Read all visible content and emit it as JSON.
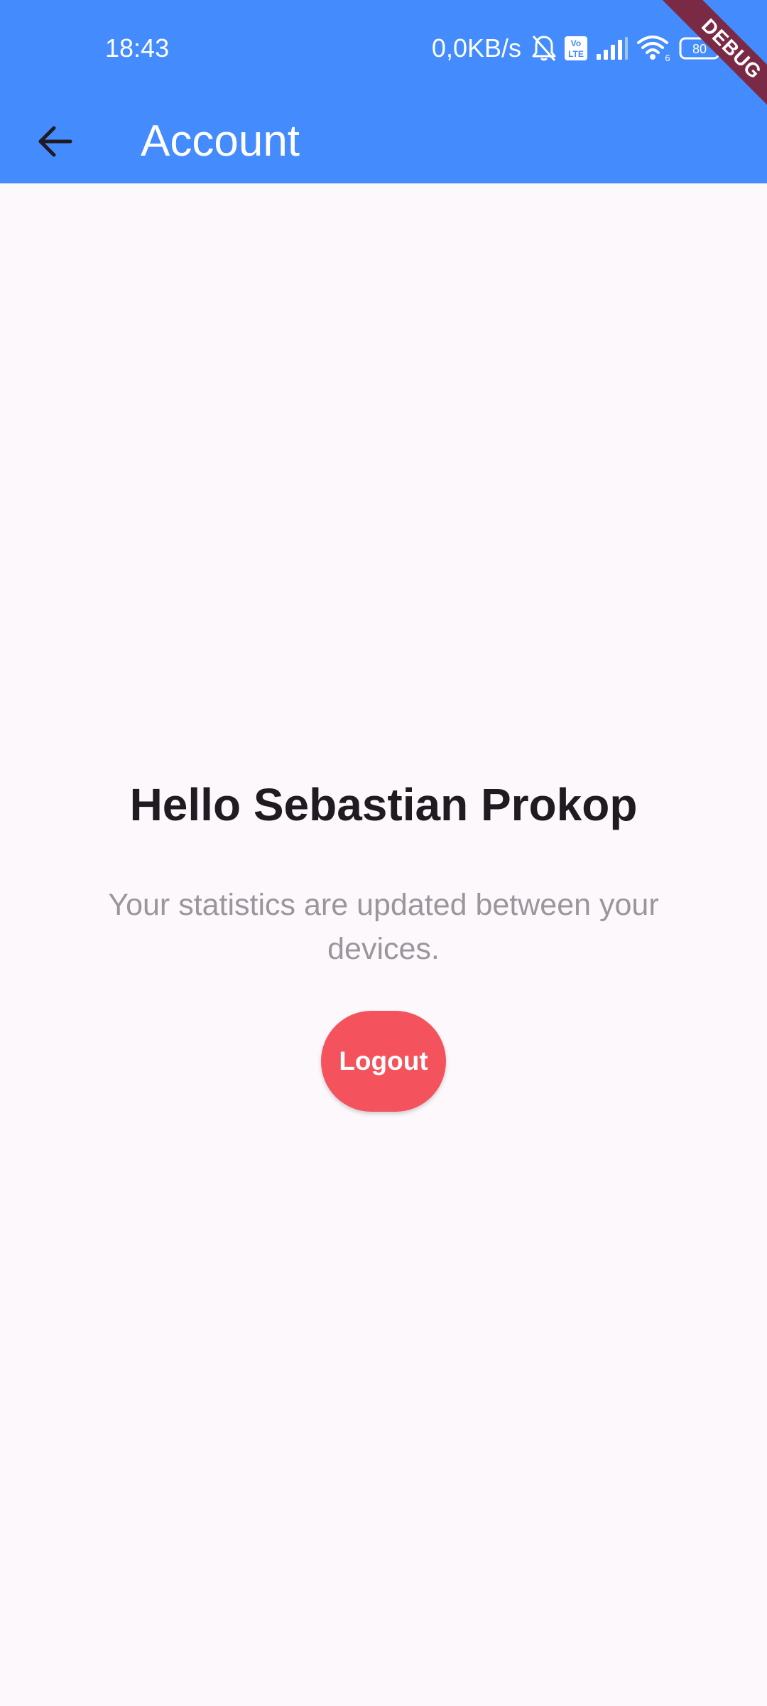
{
  "status_bar": {
    "time": "18:43",
    "network_speed": "0,0KB/s",
    "battery_level": "80",
    "wifi_sub": "6",
    "volte_top": "Vo",
    "volte_bottom": "LTE",
    "icons": [
      "bell-off-icon",
      "volte-icon",
      "signal-icon",
      "wifi-icon",
      "battery-icon"
    ]
  },
  "app_bar": {
    "title": "Account",
    "back_icon": "arrow-left-icon",
    "background_color": "#448bfe"
  },
  "debug_banner": {
    "label": "DEBUG",
    "color": "#7b2a45"
  },
  "main": {
    "greeting": "Hello Sebastian Prokop",
    "subtitle": "Your statistics are updated between your devices.",
    "logout_label": "Logout",
    "logout_color": "#f4525c"
  }
}
